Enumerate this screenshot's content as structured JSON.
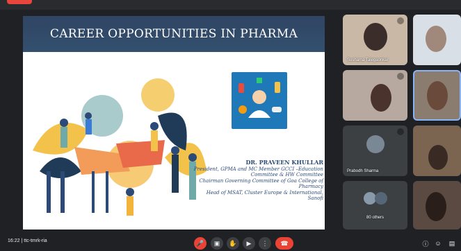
{
  "meeting": {
    "time": "16:22",
    "code": "ttc-tmrk-ria"
  },
  "slide": {
    "title": "CAREER OPPORTUNITIES IN PHARMA",
    "speaker_name": "DR. PRAVEEN KHULLAR",
    "speaker_lines": [
      "President, GPMA and MC Member GCCI –Education",
      "Committee & HW Committee",
      "Chairman Governing Committee of Goa College of",
      "Pharmacy",
      "Head of MSAT, Cluster Europe & International,",
      "Sanofi"
    ]
  },
  "participants": [
    {
      "name": "Sushama Talegaonkar"
    },
    {
      "name": ""
    },
    {
      "name": ""
    },
    {
      "name": ""
    },
    {
      "name": "Prabodh Sharma"
    },
    {
      "name": ""
    },
    {
      "name": "80 others"
    },
    {
      "name": ""
    }
  ],
  "controls": {
    "mic": "mic-off-icon",
    "camera": "camera-icon",
    "raise_hand": "hand-icon",
    "present": "present-icon",
    "more": "more-icon",
    "end_call": "end-call-icon"
  },
  "colors": {
    "slide_header": "#2f4563",
    "mic_off": "#ea4335",
    "end_call": "#ea4335"
  }
}
